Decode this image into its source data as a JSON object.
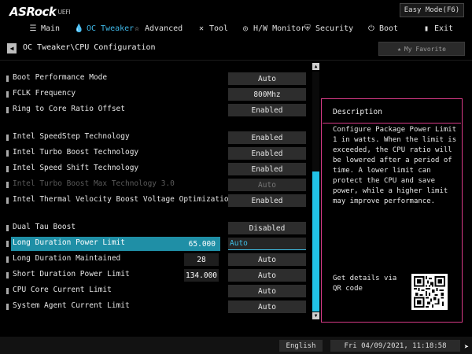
{
  "brand": {
    "logo": "ASRock",
    "logo_sub": "UEFI"
  },
  "easy_mode_label": "Easy Mode(F6)",
  "menu": [
    {
      "label": "Main",
      "icon": "list-icon"
    },
    {
      "label": "OC Tweaker",
      "icon": "flame-icon"
    },
    {
      "label": "Advanced",
      "icon": "star-icon"
    },
    {
      "label": "Tool",
      "icon": "wrench-icon"
    },
    {
      "label": "H/W Monitor",
      "icon": "monitor-icon"
    },
    {
      "label": "Security",
      "icon": "shield-icon"
    },
    {
      "label": "Boot",
      "icon": "power-icon"
    },
    {
      "label": "Exit",
      "icon": "exit-icon"
    }
  ],
  "breadcrumb": "OC Tweaker\\CPU Configuration",
  "favorite_label": "My Favorite",
  "settings": [
    {
      "label": "Boot Performance Mode",
      "value": "Auto"
    },
    {
      "label": "FCLK Frequency",
      "value": "800Mhz"
    },
    {
      "label": "Ring to Core Ratio Offset",
      "value": "Enabled"
    },
    {
      "label": "Intel SpeedStep Technology",
      "value": "Enabled"
    },
    {
      "label": "Intel Turbo Boost Technology",
      "value": "Enabled"
    },
    {
      "label": "Intel Speed Shift Technology",
      "value": "Enabled"
    },
    {
      "label": "Intel Turbo Boost Max Technology 3.0",
      "value": "Auto"
    },
    {
      "label": "Intel Thermal Velocity Boost Voltage Optimizations",
      "value": "Enabled"
    },
    {
      "label": "Dual Tau Boost",
      "value": "Disabled"
    },
    {
      "label": "Long Duration Power Limit",
      "number": "65.000",
      "value": "Auto"
    },
    {
      "label": "Long Duration Maintained",
      "number": "28",
      "value": "Auto"
    },
    {
      "label": "Short Duration Power Limit",
      "number": "134.000",
      "value": "Auto"
    },
    {
      "label": "CPU Core Current Limit",
      "value": "Auto"
    },
    {
      "label": "System Agent Current Limit",
      "value": "Auto"
    }
  ],
  "description": {
    "title": "Description",
    "text": "Configure Package Power Limit 1 in watts. When the limit is exceeded, the CPU ratio will be lowered after a period of time. A lower limit can protect the CPU and save power, while a higher limit may improve performance.",
    "qr_label": "Get details via QR code"
  },
  "footer": {
    "language": "English",
    "datetime": "Fri 04/09/2021, 11:18:58"
  },
  "colors": {
    "accent": "#21c2e6",
    "selection": "#1f8fa6",
    "description_border": "#d73a86"
  }
}
